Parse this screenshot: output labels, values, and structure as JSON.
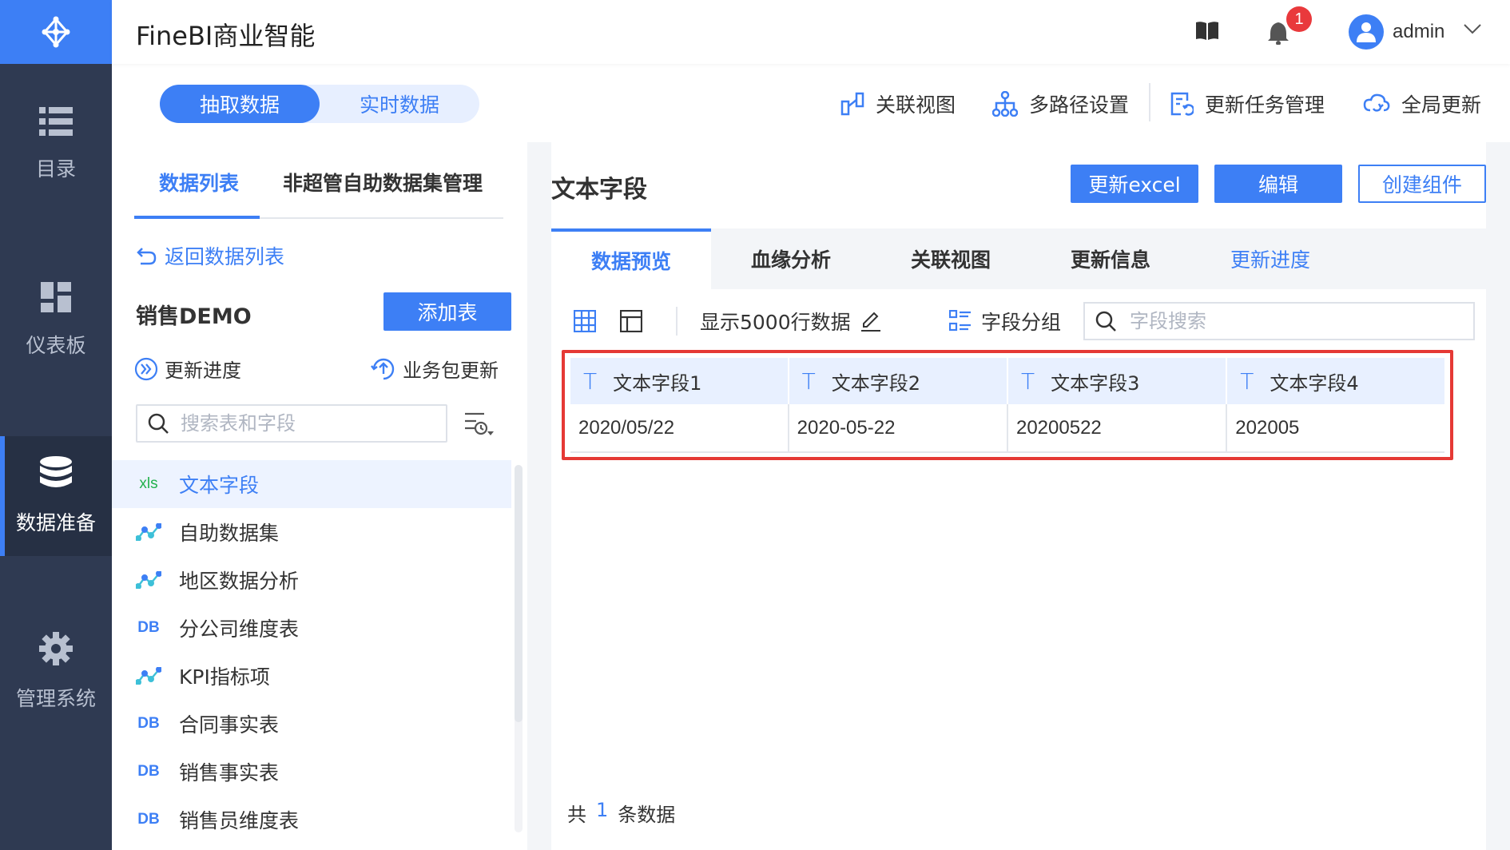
{
  "app": {
    "title": "FineBI商业智能",
    "user": "admin",
    "notification_count": "1"
  },
  "rail": {
    "items": [
      {
        "label": "目录",
        "icon": "list-icon"
      },
      {
        "label": "仪表板",
        "icon": "dashboard-icon"
      },
      {
        "label": "数据准备",
        "icon": "database-icon",
        "active": true
      },
      {
        "label": "管理系统",
        "icon": "gear-icon"
      }
    ]
  },
  "toolbar": {
    "mode_extract": "抽取数据",
    "mode_realtime": "实时数据",
    "relation_view": "关联视图",
    "multi_path": "多路径设置",
    "update_task": "更新任务管理",
    "global_update": "全局更新"
  },
  "left_panel": {
    "tab_data_list": "数据列表",
    "tab_non_super": "非超管自助数据集管理",
    "back_link": "返回数据列表",
    "package_name": "销售DEMO",
    "add_table": "添加表",
    "update_progress": "更新进度",
    "package_update": "业务包更新",
    "search_placeholder": "搜索表和字段",
    "tables": [
      {
        "label": "文本字段",
        "type": "xls",
        "type_label": "xls",
        "selected": true
      },
      {
        "label": "自助数据集",
        "type": "selfservice"
      },
      {
        "label": "地区数据分析",
        "type": "selfservice"
      },
      {
        "label": "分公司维度表",
        "type": "db",
        "type_label": "DB"
      },
      {
        "label": "KPI指标项",
        "type": "selfservice"
      },
      {
        "label": "合同事实表",
        "type": "db",
        "type_label": "DB"
      },
      {
        "label": "销售事实表",
        "type": "db",
        "type_label": "DB"
      },
      {
        "label": "销售员维度表",
        "type": "db",
        "type_label": "DB"
      }
    ]
  },
  "detail": {
    "title": "文本字段",
    "btn_update_excel": "更新excel",
    "btn_edit": "编辑",
    "btn_create": "创建组件",
    "tabs": [
      "数据预览",
      "血缘分析",
      "关联视图",
      "更新信息",
      "更新进度"
    ],
    "show_rows": "显示5000行数据",
    "field_group": "字段分组",
    "field_search_placeholder": "字段搜索",
    "columns": [
      "文本字段1",
      "文本字段2",
      "文本字段3",
      "文本字段4"
    ],
    "rows": [
      [
        "2020/05/22",
        "2020-05-22",
        "20200522",
        "202005"
      ]
    ],
    "column_type_mark": "T",
    "count_prefix": "共",
    "count_value": "1",
    "count_suffix": "条数据"
  },
  "colors": {
    "accent": "#3d7ff5",
    "rail": "#2f3a52",
    "highlight_border": "#e53935",
    "badge": "#e9393c"
  }
}
